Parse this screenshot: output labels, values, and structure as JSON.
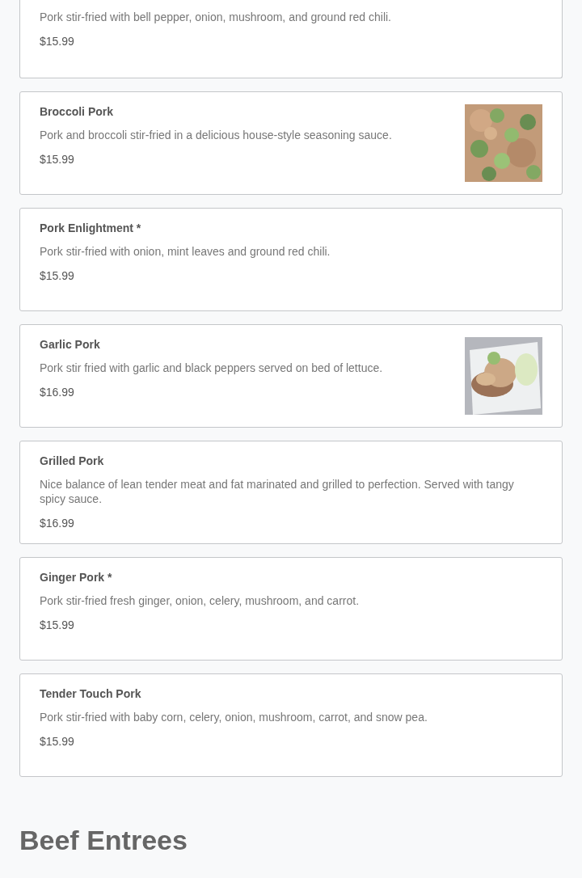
{
  "sections": [
    {
      "items": [
        {
          "description": "Pork stir-fried with bell pepper, onion, mushroom, and ground red chili.",
          "price": "$15.99"
        },
        {
          "name": "Broccoli Pork",
          "description": "Pork and broccoli stir-fried in a delicious house-style seasoning sauce.",
          "price": "$15.99"
        },
        {
          "name": "Pork Enlightment *",
          "description": "Pork stir-fried with onion, mint leaves and ground red chili.",
          "price": "$15.99"
        },
        {
          "name": "Garlic Pork",
          "description": "Pork stir fried with garlic and black peppers served on bed of lettuce.",
          "price": "$16.99"
        },
        {
          "name": "Grilled Pork",
          "description": "Nice balance of lean tender meat and fat marinated and grilled to perfection. Served with tangy spicy sauce.",
          "price": "$16.99"
        },
        {
          "name": "Ginger Pork *",
          "description": "Pork stir-fried fresh ginger, onion, celery, mushroom, and carrot.",
          "price": "$15.99"
        },
        {
          "name": "Tender Touch Pork",
          "description": "Pork stir-fried with baby corn, celery, onion, mushroom, carrot, and snow pea.",
          "price": "$15.99"
        }
      ]
    },
    {
      "title": "Beef Entrees"
    }
  ]
}
